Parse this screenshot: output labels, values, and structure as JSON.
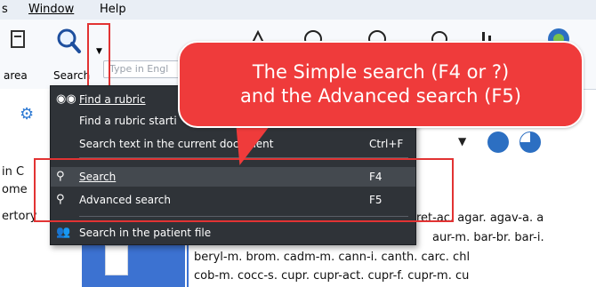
{
  "menubar": {
    "item1": "s",
    "window": "Window",
    "help": "Help"
  },
  "ribbon": {
    "area_label": "area",
    "search_label": "Search",
    "search_placeholder": "Type in Engl"
  },
  "callout": {
    "line1": "The Simple search (F4 or ?)",
    "line2": "and the Advanced search (F5)"
  },
  "menu": {
    "items": [
      {
        "label": "Find a rubric",
        "shortcut": ""
      },
      {
        "label": "Find a rubric starti",
        "shortcut": ""
      },
      {
        "label": "Search text in the current document",
        "shortcut": "Ctrl+F"
      },
      {
        "label": "Search",
        "shortcut": "F4"
      },
      {
        "label": "Advanced search",
        "shortcut": "F5"
      },
      {
        "label": "Search in the patient file",
        "shortcut": ""
      }
    ]
  },
  "left": {
    "in_c": "in C",
    "ome": "ome",
    "ertory": "ertory"
  },
  "document": {
    "line1": "ret-ac. agar. agav-a. a",
    "line2": "aur-m. bar-br. bar-i.",
    "line3": "beryl-m. brom. cadm-m. cann-i. canth. carc. chl",
    "line4": "cob-m. cocc-s. cupr. cupr-act. cupr-f. cupr-m. cu"
  }
}
